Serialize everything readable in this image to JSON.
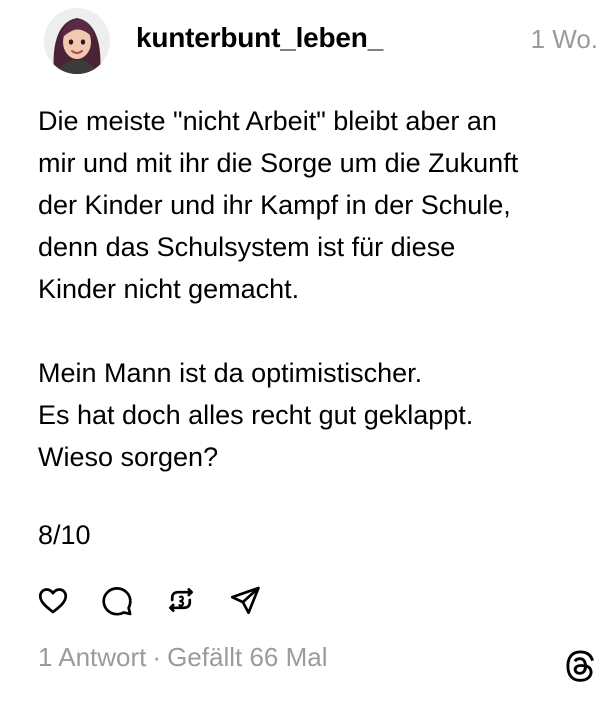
{
  "post": {
    "username": "kunterbunt_leben_",
    "timestamp": "1 Wo.",
    "body_lines": [
      "Die meiste \"nicht Arbeit\" bleibt aber an",
      "mir und mit ihr die Sorge um die Zukunft",
      "der Kinder und ihr Kampf in der Schule,",
      "denn das Schulsystem ist für diese",
      "Kinder nicht gemacht.",
      "",
      "Mein Mann ist da optimistischer.",
      "Es hat doch alles recht gut geklappt.",
      "Wieso sorgen?"
    ],
    "counter": "8/10",
    "replies_label": "1 Antwort",
    "separator": "·",
    "likes_label": "Gefällt 66 Mal"
  },
  "actions": [
    {
      "name": "like",
      "icon": "heart-icon"
    },
    {
      "name": "reply",
      "icon": "comment-bubble-icon"
    },
    {
      "name": "repost",
      "icon": "repost-icon"
    },
    {
      "name": "share",
      "icon": "send-icon"
    }
  ],
  "colors": {
    "text": "#000000",
    "muted": "#9b9b9b",
    "background": "#ffffff"
  }
}
